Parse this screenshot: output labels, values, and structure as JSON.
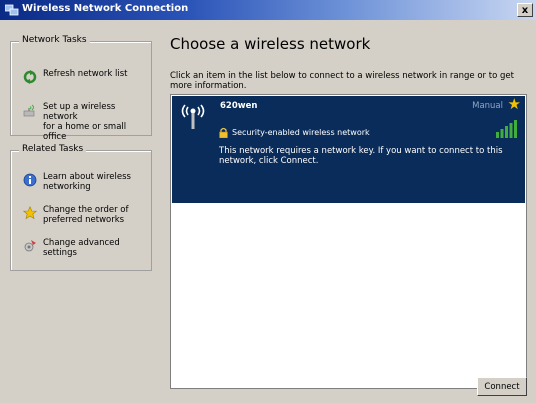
{
  "window": {
    "title": "Wireless Network Connection",
    "close_label": "x"
  },
  "sidebar": {
    "network_tasks": {
      "title": "Network Tasks",
      "items": [
        {
          "label": "Refresh network list",
          "icon": "refresh-icon"
        },
        {
          "label": "Set up a wireless network\nfor a home or small office",
          "icon": "wireless-setup-icon"
        }
      ]
    },
    "related_tasks": {
      "title": "Related Tasks",
      "items": [
        {
          "label": "Learn about wireless\nnetworking",
          "icon": "info-icon"
        },
        {
          "label": "Change the order of\npreferred networks",
          "icon": "star-icon"
        },
        {
          "label": "Change advanced\nsettings",
          "icon": "settings-icon"
        }
      ]
    }
  },
  "main": {
    "heading": "Choose a wireless network",
    "instructions": "Click an item in the list below to connect to a wireless network in range or to get more information.",
    "networks": [
      {
        "name": "620wen",
        "connection_type": "Manual",
        "security": "Security-enabled wireless network",
        "description": "This network requires a network key. If you want to connect to this network, click Connect.",
        "signal_bars": 5
      }
    ],
    "connect_button": "Connect"
  },
  "colors": {
    "titlebar_start": "#0a2a86",
    "selection": "#0a2c5a",
    "signal": "#3fae3f",
    "star": "#f2c200"
  }
}
